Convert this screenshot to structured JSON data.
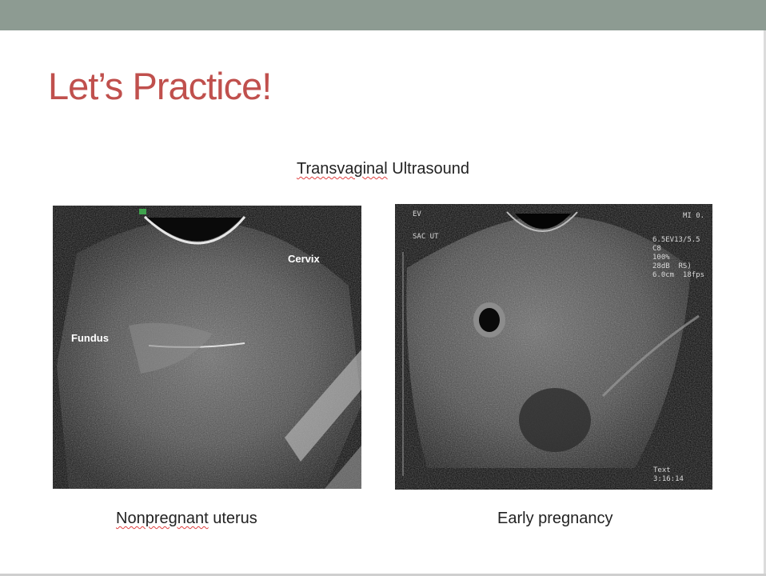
{
  "slide": {
    "title": "Let’s Practice!",
    "subtitle_part1": "Transvaginal",
    "subtitle_part2": " Ultrasound"
  },
  "left_image": {
    "label_cervix": "Cervix",
    "label_fundus": "Fundus",
    "caption_part1": "Nonpregnant",
    "caption_part2": " uterus"
  },
  "right_image": {
    "overlay_top_left": "EV",
    "overlay_sac": "SAC UT",
    "overlay_top_right": "MI 0.",
    "overlay_params": "6.5EV13/5.5\nC8\n100%\n28dB  RS)\n6.0cm  18fps",
    "overlay_bottom_right": "Text\n3:16:14",
    "caption": "Early pregnancy"
  },
  "colors": {
    "top_bar": "#8d9b92",
    "title": "#c0504d",
    "spellcheck_underline": "#e04040"
  }
}
